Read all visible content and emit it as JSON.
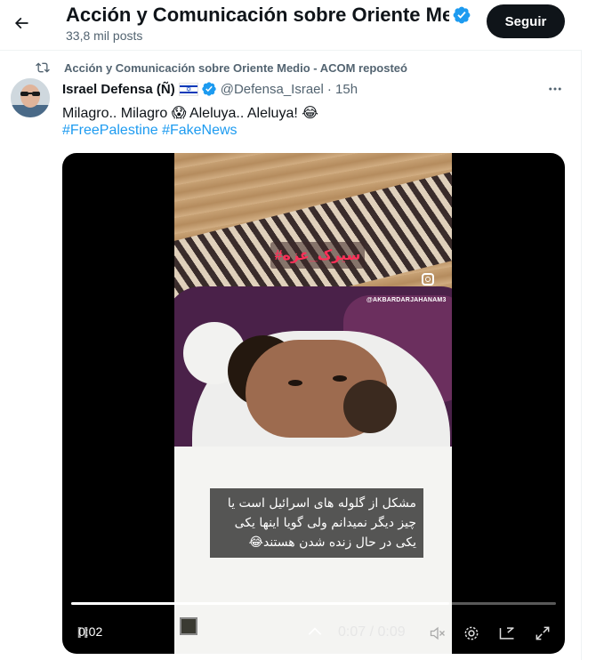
{
  "header": {
    "title": "Acción y Comunicación sobre Oriente Medio - ACOM",
    "posts_count": "33,8 mil posts",
    "follow_label": "Seguir"
  },
  "tweet": {
    "repost_text": "Acción y Comunicación sobre Oriente Medio - ACOM reposteó",
    "author_name": "Israel Defensa (Ñ)",
    "handle": "@Defensa_Israel",
    "time": "· 15h",
    "text_line1": "Milagro.. Milagro 😱  Aleluya.. Aleluya! 😂",
    "hashtags": [
      "#FreePalestine",
      "#FakeNews"
    ]
  },
  "video": {
    "overlay_banner": "#سیرک_عزه",
    "watermark": "@AKBARDARJAHANAM3",
    "subtitle": "مشکل از گلوله های اسرائیل است یا چیز دیگر نمیدانم ولی گویا اینها یکی یکی در حال زنده شدن هستند😂",
    "elapsed": "0:02",
    "timecode": "0:07 / 0:09",
    "progress": 0.78
  },
  "colors": {
    "accent": "#1d9bf0",
    "text_primary": "#0f1419",
    "text_secondary": "#536471",
    "follow_bg": "#0f1419"
  },
  "icons": {
    "back": "arrow-left-icon",
    "verified": "verified-badge-icon",
    "repost": "repost-icon",
    "more": "more-icon"
  }
}
